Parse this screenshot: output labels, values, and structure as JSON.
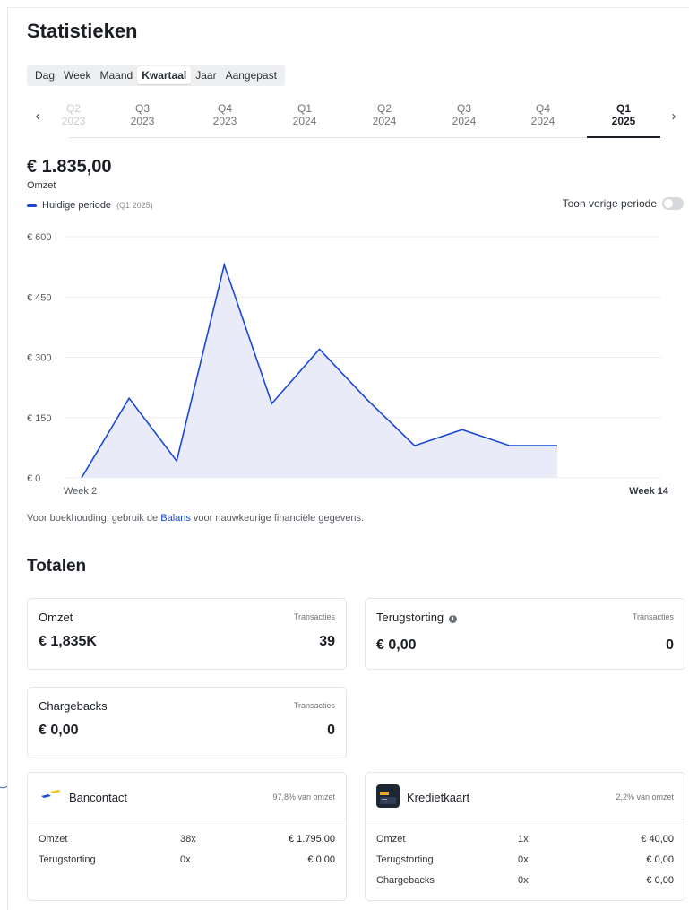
{
  "page": {
    "title": "Statistieken"
  },
  "period_tabs": [
    "Dag",
    "Week",
    "Maand",
    "Kwartaal",
    "Jaar",
    "Aangepast"
  ],
  "active_period_tab": "Kwartaal",
  "quarter_nav": {
    "items": [
      {
        "q": "Q2",
        "y": "2023"
      },
      {
        "q": "Q3",
        "y": "2023"
      },
      {
        "q": "Q4",
        "y": "2023"
      },
      {
        "q": "Q1",
        "y": "2024"
      },
      {
        "q": "Q2",
        "y": "2024"
      },
      {
        "q": "Q3",
        "y": "2024"
      },
      {
        "q": "Q4",
        "y": "2024"
      },
      {
        "q": "Q1",
        "y": "2025"
      }
    ],
    "active_index": 7,
    "prev_icon": "‹",
    "next_icon": "›"
  },
  "summary": {
    "amount": "€ 1.835,00",
    "label": "Omzet",
    "legend_label": "Huidige periode",
    "legend_period": "(Q1 2025)",
    "toggle_label": "Toon vorige periode",
    "toggle_on": false
  },
  "chart_data": {
    "type": "area",
    "series": [
      {
        "name": "Huidige periode",
        "values": [
          0,
          198,
          42,
          530,
          185,
          320,
          195,
          80,
          120,
          80,
          80
        ]
      }
    ],
    "y_ticks": [
      "€ 0",
      "€ 150",
      "€ 300",
      "€ 450",
      "€ 600"
    ],
    "ylim": [
      0,
      600
    ],
    "x_labels": [
      "Week 2",
      "Week 14"
    ],
    "x_weeks_range": [
      2,
      14
    ],
    "color": "#1a47d4",
    "fill": "#e9ebf9",
    "grid": true
  },
  "note": {
    "before": "Voor boekhouding: gebruik de ",
    "link": "Balans",
    "after": " voor nauwkeurige financiële gegevens."
  },
  "totals": {
    "title": "Totalen",
    "cards": [
      {
        "title": "Omzet",
        "tx_label": "Transacties",
        "value": "€ 1,835K",
        "count": "39"
      },
      {
        "title": "Terugstorting",
        "tx_label": "Transacties",
        "value": "€ 0,00",
        "count": "0"
      },
      {
        "title": "Chargebacks",
        "tx_label": "Transacties",
        "value": "€ 0,00",
        "count": "0"
      }
    ]
  },
  "payment_methods": [
    {
      "name": "Bancontact",
      "share": "97,8% van omzet",
      "rows": [
        {
          "label": "Omzet",
          "count": "38x",
          "amount": "€ 1.795,00"
        },
        {
          "label": "Terugstorting",
          "count": "0x",
          "amount": "€ 0,00"
        }
      ]
    },
    {
      "name": "Kredietkaart",
      "share": "2,2% van omzet",
      "rows": [
        {
          "label": "Omzet",
          "count": "1x",
          "amount": "€ 40,00"
        },
        {
          "label": "Terugstorting",
          "count": "0x",
          "amount": "€ 0,00"
        },
        {
          "label": "Chargebacks",
          "count": "0x",
          "amount": "€ 0,00"
        }
      ]
    }
  ],
  "colors": {
    "accent": "#1a47d4",
    "bancontact_blue": "#1e4fd6",
    "bancontact_yellow": "#f7c419"
  }
}
